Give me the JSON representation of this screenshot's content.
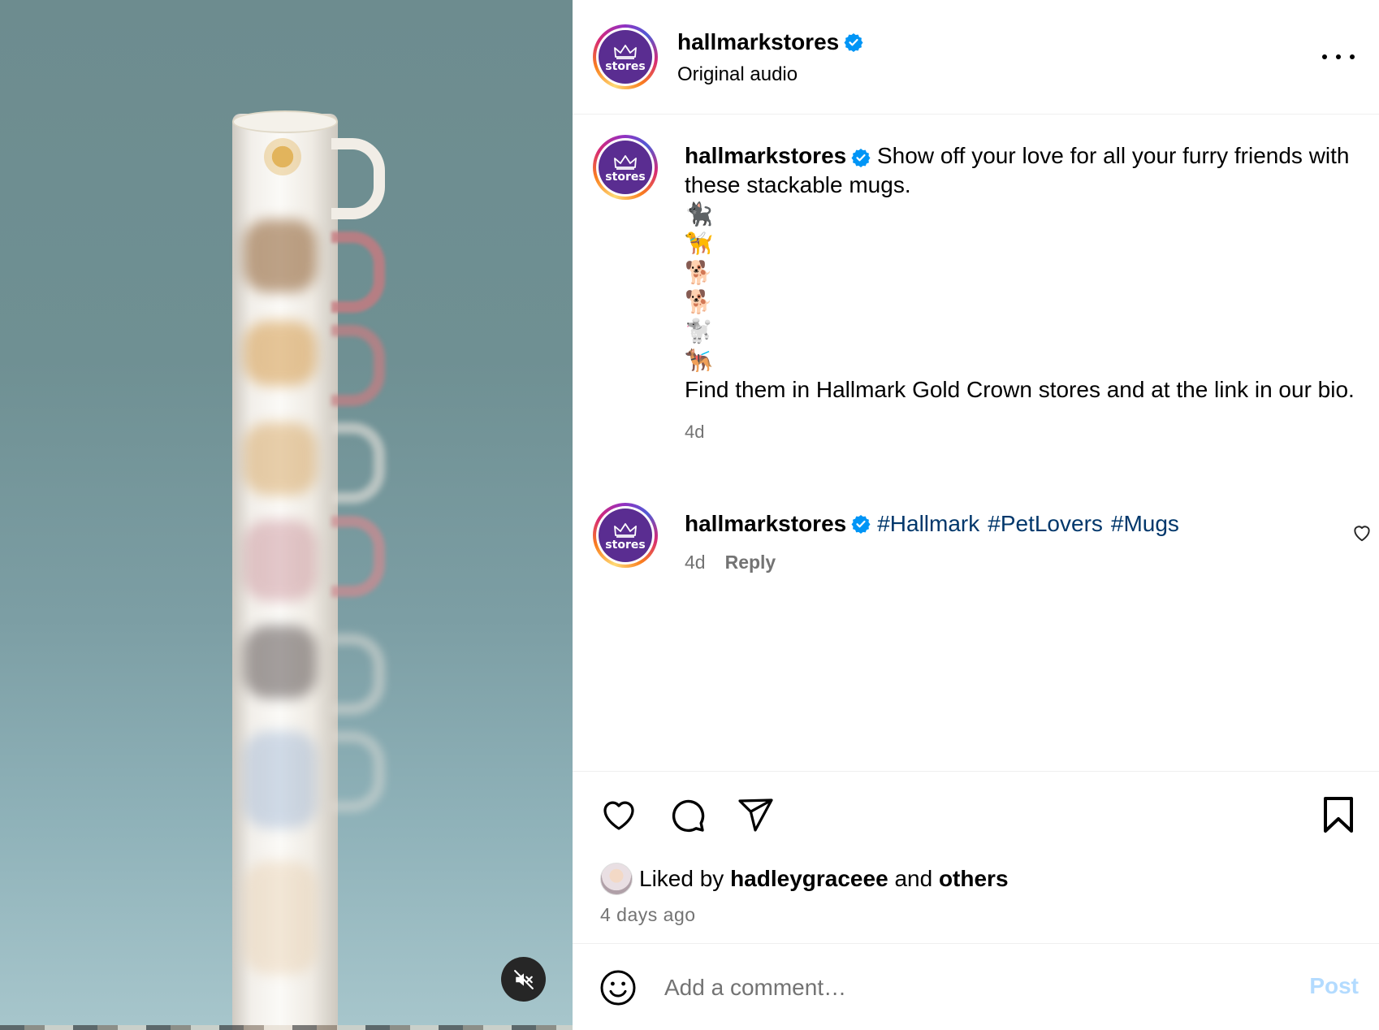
{
  "post": {
    "username": "hallmarkstores",
    "avatar_label": "stores",
    "audio_label": "Original audio"
  },
  "caption": {
    "username": "hallmarkstores",
    "text": "Show off your love for all your furry friends with these stackable mugs.",
    "emojis": [
      "🐈‍⬛",
      "🦮",
      "🐕",
      "🐕",
      "🐩",
      "🐕‍🦺"
    ],
    "text_2": "Find them in Hallmark Gold Crown stores and at the link in our bio.",
    "time": "4d"
  },
  "hashtag_comment": {
    "username": "hallmarkstores",
    "hashtags": [
      "#Hallmark",
      "#PetLovers",
      "#Mugs"
    ],
    "time": "4d",
    "reply_label": "Reply"
  },
  "likes": {
    "prefix": "Liked by",
    "user": "hadleygraceee",
    "connector": "and",
    "others": "others",
    "posted_ago": "4 days ago"
  },
  "comment_box": {
    "placeholder": "Add a comment…",
    "post_label": "Post"
  },
  "colors": {
    "avatar_bg": "#5a2d91",
    "verified": "#0095f6",
    "hashtag": "#00376b",
    "post_disabled": "#b3dbff",
    "muted_text": "#737373"
  }
}
